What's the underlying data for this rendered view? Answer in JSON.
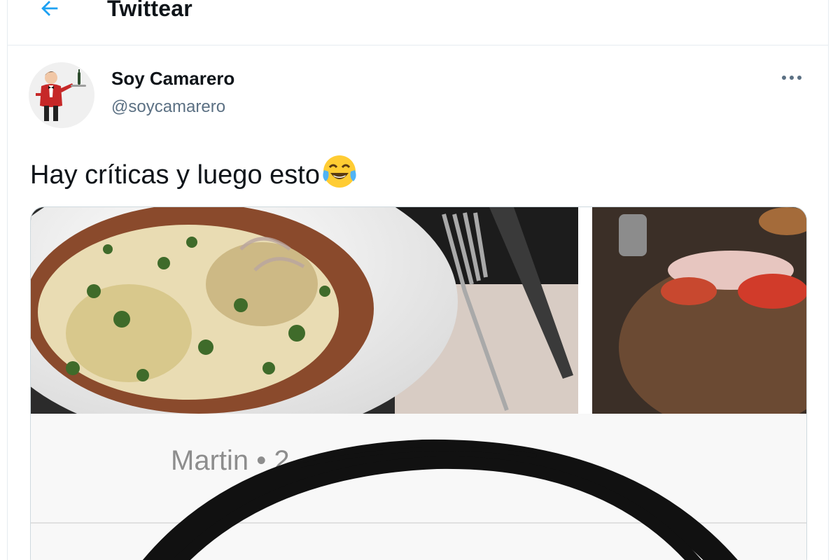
{
  "header": {
    "title": "Twittear",
    "back_icon": "arrow-left-icon",
    "accent_color": "#1da1f2"
  },
  "tweet": {
    "author": {
      "display_name": "Soy Camarero",
      "handle": "@soycamarero",
      "avatar_icon": "waiter-avatar"
    },
    "more_icon": "more-horizontal-icon",
    "text": "Hay críticas y luego esto",
    "emoji_icon": "face-with-tears-of-joy-icon",
    "media": {
      "image_description_icon": "food-photo",
      "review_author_text": "Martin • 2"
    }
  }
}
